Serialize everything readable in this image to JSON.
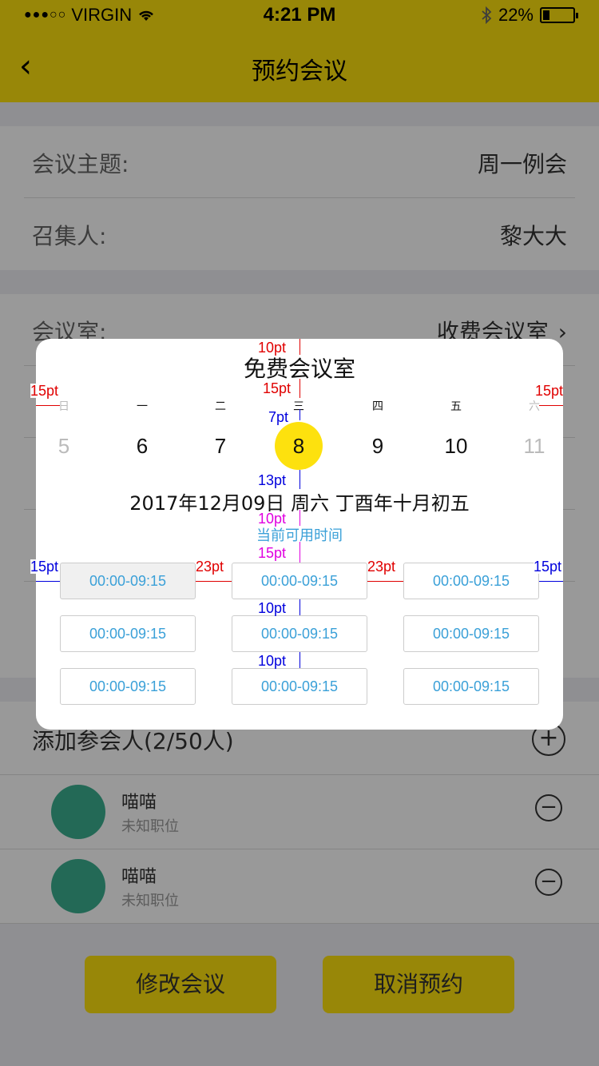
{
  "status_bar": {
    "signal": "●●●○○",
    "carrier": "VIRGIN",
    "time": "4:21 PM",
    "battery": "22%"
  },
  "nav": {
    "back": "‹",
    "title": "预约会议"
  },
  "form": {
    "topic_label": "会议主题:",
    "topic_value": "周一例会",
    "host_label": "召集人:",
    "host_value": "黎大大",
    "room_label": "会议室:",
    "room_value": "收费会议室"
  },
  "participants": {
    "header": "添加参会人(2/50人)",
    "list": [
      {
        "name": "喵喵",
        "role": "未知职位"
      },
      {
        "name": "喵喵",
        "role": "未知职位"
      }
    ]
  },
  "buttons": {
    "modify": "修改会议",
    "cancel": "取消预约"
  },
  "modal": {
    "title": "免费会议室",
    "weekdays": [
      "日",
      "一",
      "二",
      "三",
      "四",
      "五",
      "六"
    ],
    "dates": [
      "5",
      "6",
      "7",
      "8",
      "9",
      "10",
      "11"
    ],
    "selected_index": 3,
    "full_date": "2017年12月09日  周六   丁酉年十月初五",
    "available_label": "当前可用时间",
    "slots": [
      "00:00-09:15",
      "00:00-09:15",
      "00:00-09:15",
      "00:00-09:15",
      "00:00-09:15",
      "00:00-09:15",
      "00:00-09:15",
      "00:00-09:15",
      "00:00-09:15"
    ]
  },
  "annotations": {
    "top_gap": "10pt",
    "title_gap": "15pt",
    "side_left": "15pt",
    "side_right": "15pt",
    "weekday_gap": "7pt",
    "date_gap": "13pt",
    "avail_gap_top": "10pt",
    "avail_gap_bottom": "15pt",
    "slot_left": "15pt",
    "slot_gap1": "23pt",
    "slot_gap2": "23pt",
    "slot_right": "15pt",
    "row_gap1": "10pt",
    "row_gap2": "10pt"
  },
  "colors": {
    "brand_yellow": "#fde10e",
    "avatar": "#3bb08f",
    "slot_text": "#3aa0d8"
  }
}
